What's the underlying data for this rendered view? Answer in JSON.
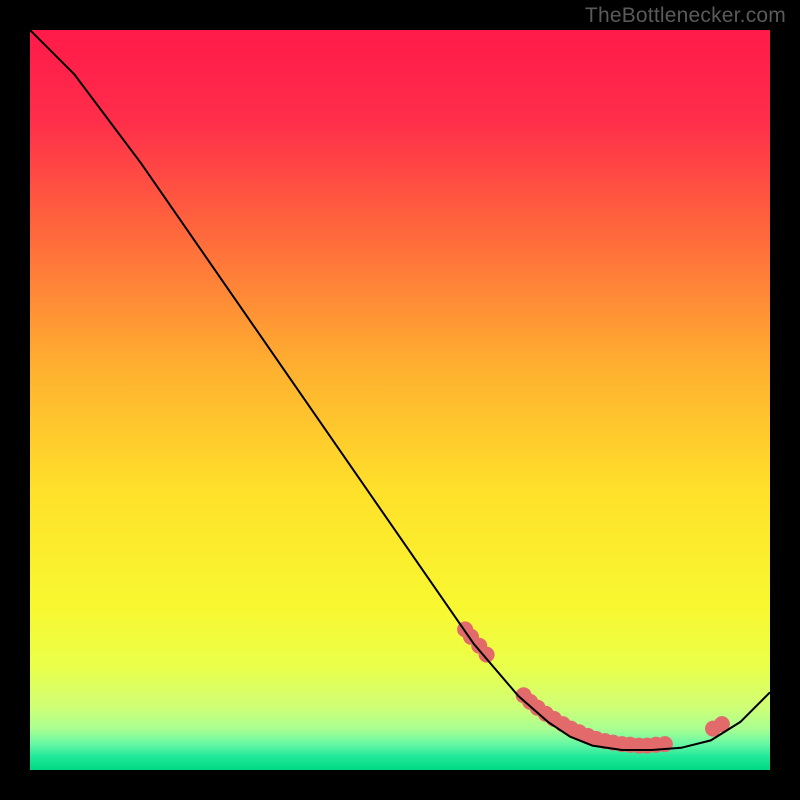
{
  "watermark": "TheBottlenecker.com",
  "chart_data": {
    "type": "line",
    "title": "",
    "xlabel": "",
    "ylabel": "",
    "xlim": [
      0,
      1
    ],
    "ylim": [
      0,
      1
    ],
    "series": [
      {
        "name": "curve",
        "color": "#000000",
        "stroke_width": 2,
        "x": [
          0.0,
          0.03,
          0.06,
          0.09,
          0.12,
          0.15,
          0.6,
          0.66,
          0.7,
          0.73,
          0.76,
          0.8,
          0.84,
          0.88,
          0.92,
          0.96,
          1.0
        ],
        "y": [
          1.0,
          0.97,
          0.94,
          0.9,
          0.86,
          0.82,
          0.17,
          0.1,
          0.065,
          0.045,
          0.033,
          0.027,
          0.027,
          0.03,
          0.04,
          0.065,
          0.105
        ]
      },
      {
        "name": "markers",
        "type": "scatter",
        "color": "#e26a6a",
        "radius": 8,
        "x": [
          0.588,
          0.596,
          0.607,
          0.617,
          0.667,
          0.676,
          0.686,
          0.697,
          0.708,
          0.72,
          0.731,
          0.742,
          0.754,
          0.765,
          0.777,
          0.788,
          0.8,
          0.811,
          0.823,
          0.834,
          0.846,
          0.858,
          0.923,
          0.935
        ],
        "y": [
          0.19,
          0.18,
          0.168,
          0.156,
          0.101,
          0.092,
          0.084,
          0.076,
          0.069,
          0.062,
          0.056,
          0.051,
          0.046,
          0.042,
          0.039,
          0.037,
          0.035,
          0.034,
          0.033,
          0.033,
          0.034,
          0.035,
          0.056,
          0.062
        ]
      }
    ],
    "gradient_stops": [
      {
        "offset": 0.0,
        "color": "#ff1a4a"
      },
      {
        "offset": 0.12,
        "color": "#ff2d4a"
      },
      {
        "offset": 0.28,
        "color": "#ff6a3c"
      },
      {
        "offset": 0.45,
        "color": "#ffae30"
      },
      {
        "offset": 0.62,
        "color": "#ffe02a"
      },
      {
        "offset": 0.78,
        "color": "#f8f830"
      },
      {
        "offset": 0.86,
        "color": "#eaff4a"
      },
      {
        "offset": 0.915,
        "color": "#cfff76"
      },
      {
        "offset": 0.945,
        "color": "#a8ff92"
      },
      {
        "offset": 0.965,
        "color": "#66f7a4"
      },
      {
        "offset": 0.982,
        "color": "#20e89a"
      },
      {
        "offset": 1.0,
        "color": "#00d982"
      }
    ]
  }
}
